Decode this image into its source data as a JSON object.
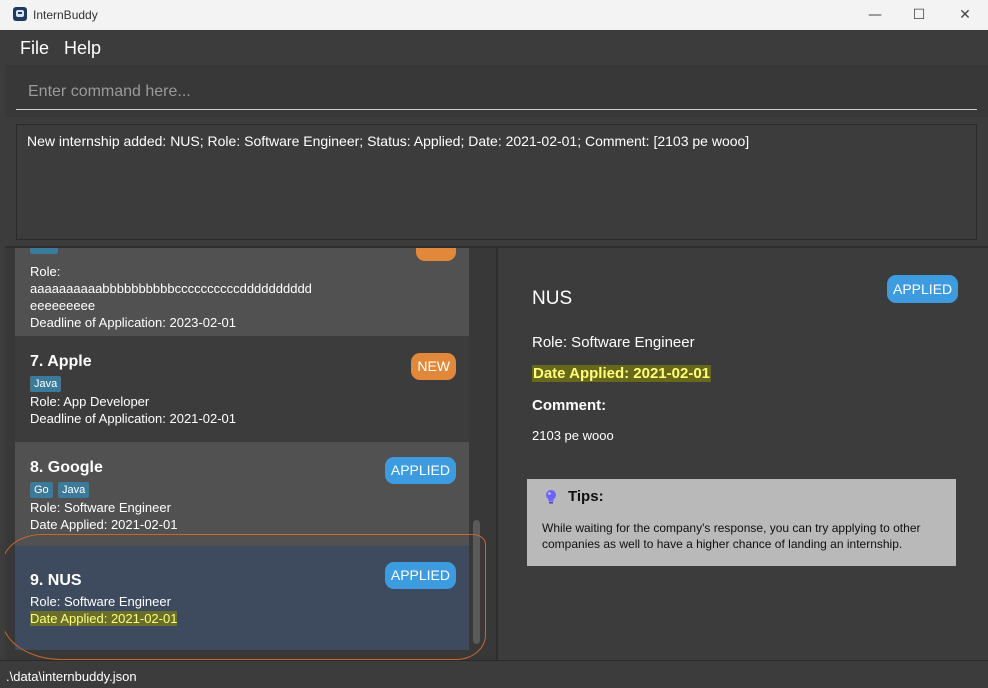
{
  "window": {
    "title": "InternBuddy",
    "minimize_glyph": "—",
    "maximize_glyph": "☐",
    "close_glyph": "✕"
  },
  "menu": {
    "file": "File",
    "help": "Help"
  },
  "command": {
    "placeholder": "Enter command here...",
    "value": ""
  },
  "result": {
    "text": "New internship added: NUS; Role: Software Engineer; Status: Applied; Date: 2021-02-01; Comment: [2103 pe wooo]"
  },
  "list": {
    "cards": [
      {
        "role_label": "Role:",
        "role_line1": "aaaaaaaaaabbbbbbbbbbccccccccccdddddddddd",
        "role_line2": "eeeeeeeee",
        "date": "Deadline of Application: 2023-02-01"
      },
      {
        "name": "7.  Apple",
        "tags": [
          "Java"
        ],
        "status": "NEW",
        "role": "Role: App Developer",
        "date": "Deadline of Application: 2021-02-01"
      },
      {
        "name": "8.  Google",
        "tags": [
          "Go",
          "Java"
        ],
        "status": "APPLIED",
        "role": "Role: Software Engineer",
        "date": "Date Applied: 2021-02-01"
      },
      {
        "name": "9.  NUS",
        "tags": [],
        "status": "APPLIED",
        "role": "Role: Software Engineer",
        "date": "Date Applied: 2021-02-01"
      }
    ]
  },
  "detail": {
    "name": "NUS",
    "status": "APPLIED",
    "role": "Role: Software Engineer",
    "date": "Date Applied: 2021-02-01",
    "comment_label": "Comment:",
    "comment": "2103 pe wooo",
    "tips": {
      "title": "Tips:",
      "text": "While waiting for the company's response, you can try applying to other companies as well to have a higher chance of landing an internship."
    }
  },
  "statusbar": {
    "path": ".\\data\\internbuddy.json"
  },
  "colors": {
    "applied": "#3d9be0",
    "new": "#e1883a",
    "tag": "#3b7a9a",
    "highlight_text": "#ffff7a",
    "annotation": "#c8662f"
  }
}
